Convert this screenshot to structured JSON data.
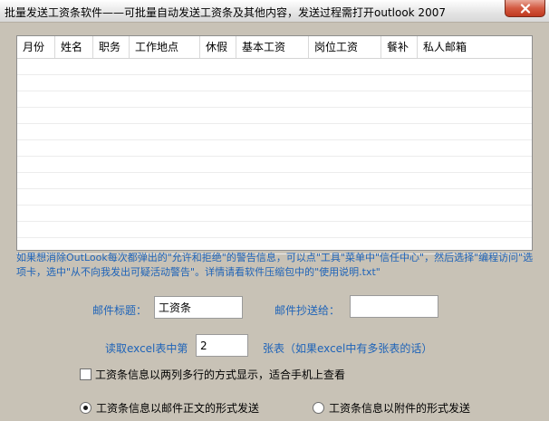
{
  "window": {
    "title": "批量发送工资条软件——可批量自动发送工资条及其他内容，发送过程需打开outlook 2007",
    "close_icon": "close-icon"
  },
  "grid": {
    "columns": [
      "月份",
      "姓名",
      "职务",
      "工作地点",
      "休假",
      "基本工资",
      "岗位工资",
      "餐补",
      "私人邮箱"
    ]
  },
  "hint": "如果想消除OutLook每次都弹出的\"允许和拒绝\"的警告信息，可以点\"工具\"菜单中\"信任中心\"，然后选择\"编程访问\"选项卡，选中\"从不向我发出可疑活动警告\"。详情请看软件压缩包中的\"使用说明.txt\"",
  "form": {
    "subject_label": "邮件标题：",
    "subject_value": "工资条",
    "cc_label": "邮件抄送给：",
    "cc_value": "",
    "sheet_label_prefix": "读取excel表中第",
    "sheet_value": "2",
    "sheet_label_suffix": "张表（如果excel中有多张表的话）"
  },
  "options": {
    "two_column_label": "工资条信息以两列多行的方式显示，适合手机上查看",
    "two_column_checked": false,
    "body_mode_label": "工资条信息以邮件正文的形式发送",
    "attachment_mode_label": "工资条信息以附件的形式发送",
    "selected_mode": "body"
  }
}
